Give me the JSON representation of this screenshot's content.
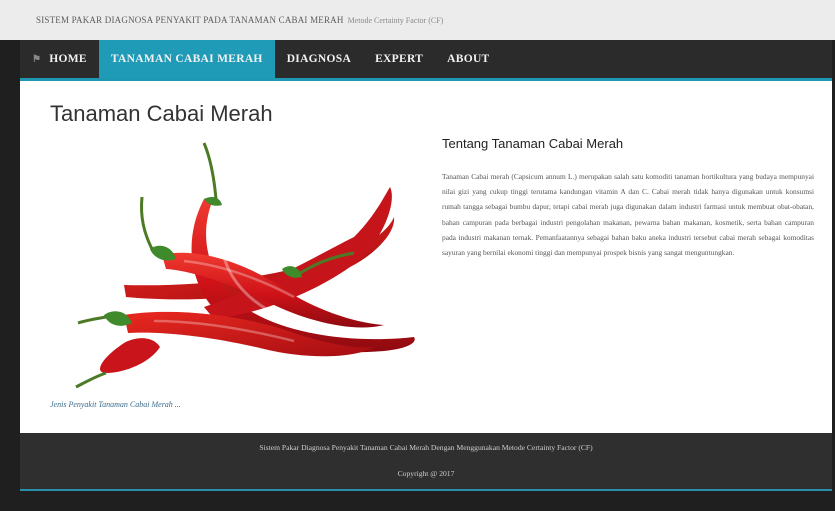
{
  "header": {
    "title": "SISTEM PAKAR DIAGNOSA PENYAKIT PADA TANAMAN CABAI MERAH",
    "subtitle": "Metode Certainty Factor (CF)"
  },
  "nav": {
    "items": [
      {
        "label": "HOME",
        "icon": "home-icon",
        "active": false
      },
      {
        "label": "TANAMAN CABAI MERAH",
        "active": true
      },
      {
        "label": "DIAGNOSA",
        "active": false
      },
      {
        "label": "EXPERT",
        "active": false
      },
      {
        "label": "ABOUT",
        "active": false
      }
    ]
  },
  "main": {
    "page_title": "Tanaman Cabai Merah",
    "image_caption": "Jenis Penyakit Tanaman Cabai Merah ...",
    "section_title": "Tentang Tanaman Cabai Merah",
    "section_body": "Tanaman Cabai merah (Capsicum annum L.) merupakan salah satu komoditi tanaman hortikultura yang budaya mempunyai nilai gizi yang cukup tinggi terutama kandungan vitamin A dan C. Cabai merah tidak hanya digunakan untuk konsumsi rumah tangga sebagai bumbu dapur, tetapi cabai merah juga digunakan dalam industri farmasi untuk membuat obat-obatan, bahan campuran pada berbagai industri pengolahan makanan, pewarna bahan makanan, kosmetik, serta bahan campuran pada industri makanan ternak. Pemanfaatannya sebagai bahan baku aneka industri tersebut cabai merah sebagai komoditas sayuran yang bernilai ekonomi tinggi dan mempunyai prospek bisnis yang sangat menguntungkan."
  },
  "footer": {
    "line1": "Sistem Pakar Diagnosa Penyakit Tanaman Cabai Merah Dengan Menggunakan Metode Certainty Factor (CF)",
    "line2": "Copyright @ 2017"
  },
  "colors": {
    "nav_bg": "#2b2b2b",
    "nav_active": "#1f9bb8",
    "footer_bg": "#2f2f2f",
    "chili_red": "#d9161c",
    "stem_green": "#3f8a2a"
  }
}
